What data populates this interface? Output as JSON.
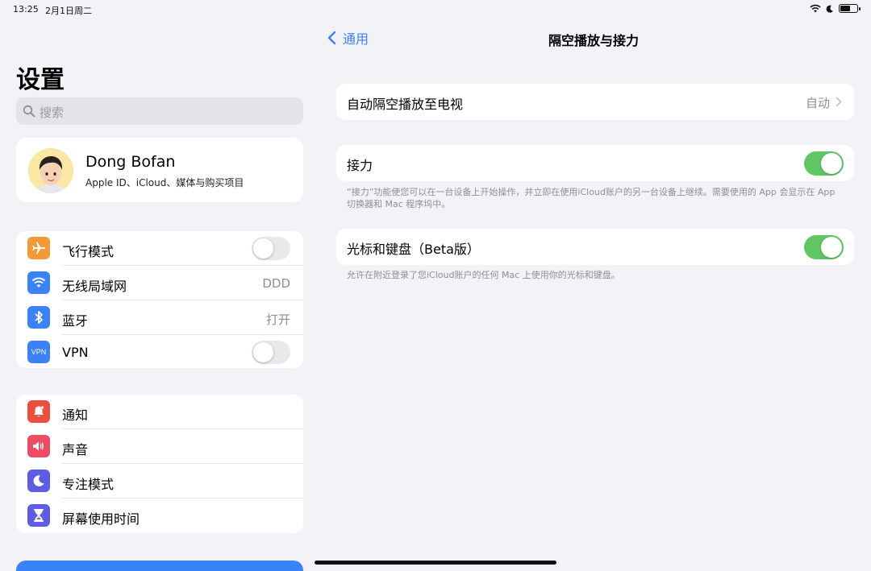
{
  "status_bar": {
    "time": "13:25",
    "date": "2月1日周二"
  },
  "sidebar": {
    "title": "设置",
    "search_placeholder": "搜索",
    "profile": {
      "name": "Dong Bofan",
      "subtitle": "Apple ID、iCloud、媒体与购买项目"
    },
    "group1": [
      {
        "label": "飞行模式",
        "icon": "airplane-icon",
        "color": "#f19a37",
        "control": "toggle",
        "on": false
      },
      {
        "label": "无线局域网",
        "icon": "wifi-icon",
        "color": "#3a82f7",
        "value": "DDD"
      },
      {
        "label": "蓝牙",
        "icon": "bluetooth-icon",
        "color": "#3a82f7",
        "value": "打开"
      },
      {
        "label": "VPN",
        "icon": "vpn-icon",
        "icon_text": "VPN",
        "color": "#3a82f7",
        "control": "toggle",
        "on": false
      }
    ],
    "group2": [
      {
        "label": "通知",
        "icon": "bell-icon",
        "color": "#eb4e3d"
      },
      {
        "label": "声音",
        "icon": "speaker-icon",
        "color": "#eb4e63"
      },
      {
        "label": "专注模式",
        "icon": "moon-icon",
        "color": "#5e5ce6"
      },
      {
        "label": "屏幕使用时间",
        "icon": "hourglass-icon",
        "color": "#5e5ce6"
      }
    ]
  },
  "detail": {
    "back_label": "通用",
    "title": "隔空播放与接力",
    "airplay": {
      "label": "自动隔空播放至电视",
      "value": "自动"
    },
    "handoff": {
      "label": "接力",
      "on": true,
      "footnote": "“接力”功能使您可以在一台设备上开始操作，并立即在使用iCloud账户的另一台设备上继续。需要使用的 App 会显示在 App 切换器和 Mac 程序坞中。"
    },
    "cursor_keyboard": {
      "label": "光标和键盘（Beta版）",
      "on": true,
      "footnote": "允许在附近登录了您iCloud账户的任何 Mac 上使用你的光标和键盘。"
    }
  },
  "colors": {
    "accent": "#3a82f7",
    "toggle_on": "#5fc666",
    "background": "#f2f2f7"
  }
}
